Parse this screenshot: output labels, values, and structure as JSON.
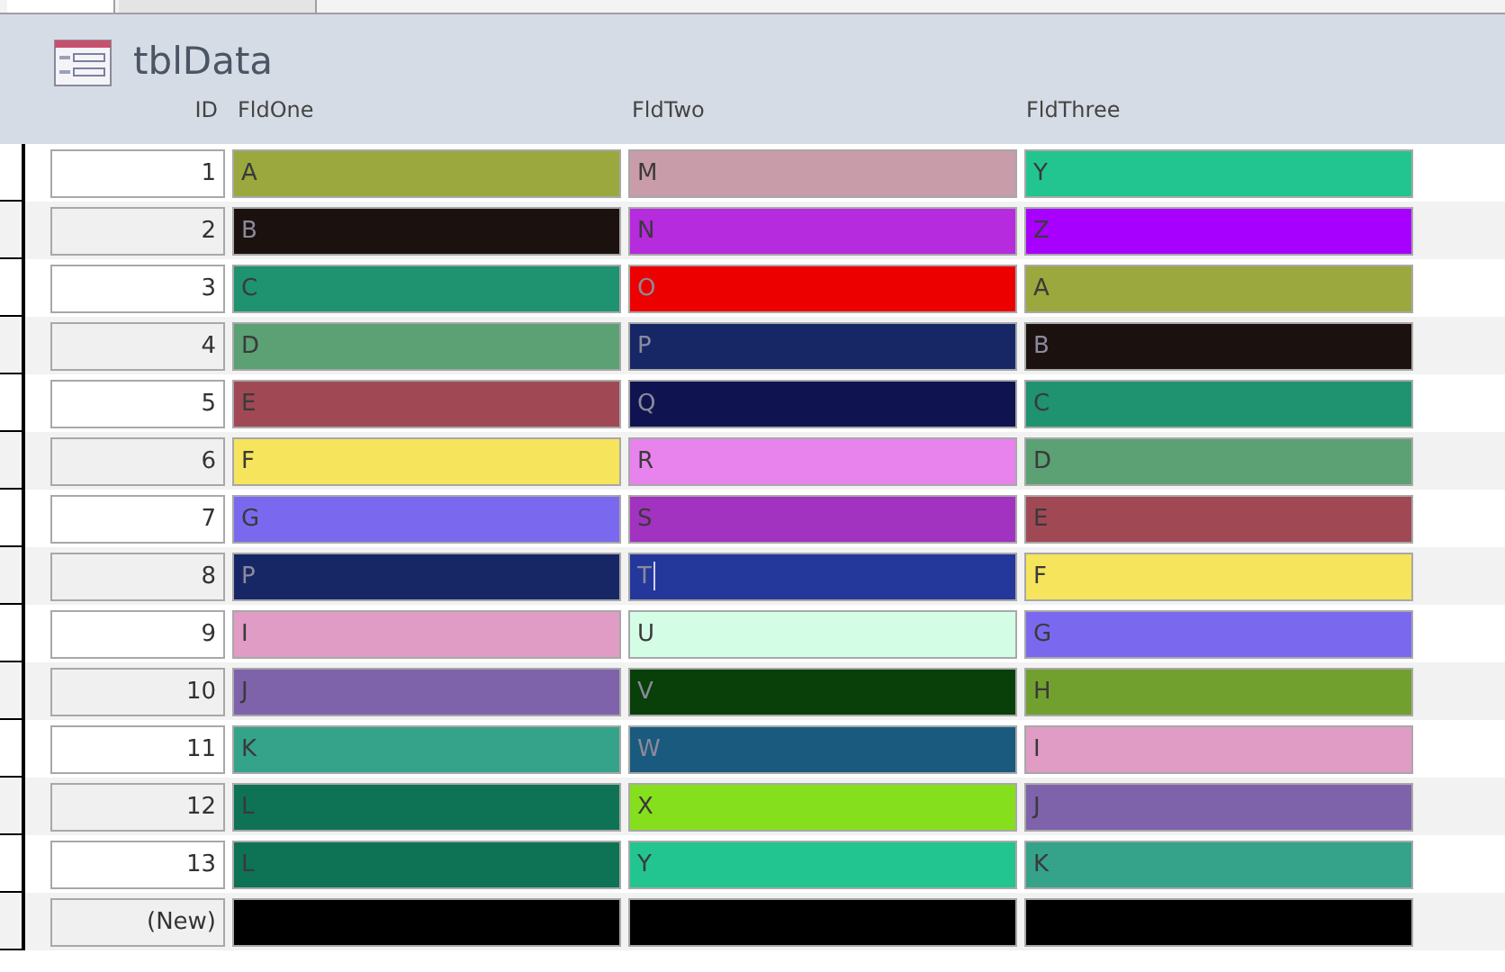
{
  "tabs": [
    {
      "selected": true
    },
    {
      "selected": false
    }
  ],
  "form": {
    "title": "tblData"
  },
  "columns": [
    "ID",
    "FldOne",
    "FldTwo",
    "FldThree"
  ],
  "rows": [
    {
      "id": "1",
      "cells": [
        {
          "value": "A",
          "color": "#9aa83e"
        },
        {
          "value": "M",
          "color": "#c89ca8"
        },
        {
          "value": "Y",
          "color": "#22c58f"
        }
      ]
    },
    {
      "id": "2",
      "cells": [
        {
          "value": "B",
          "color": "#1b1210"
        },
        {
          "value": "N",
          "color": "#b52bdd"
        },
        {
          "value": "Z",
          "color": "#a800ff"
        }
      ]
    },
    {
      "id": "3",
      "cells": [
        {
          "value": "C",
          "color": "#1f9270"
        },
        {
          "value": "O",
          "color": "#ec0000"
        },
        {
          "value": "A",
          "color": "#9aa83e"
        }
      ]
    },
    {
      "id": "4",
      "cells": [
        {
          "value": "D",
          "color": "#5ba173"
        },
        {
          "value": "P",
          "color": "#172766"
        },
        {
          "value": "B",
          "color": "#1b1210"
        }
      ]
    },
    {
      "id": "5",
      "cells": [
        {
          "value": "E",
          "color": "#a04955"
        },
        {
          "value": "Q",
          "color": "#0f1450"
        },
        {
          "value": "C",
          "color": "#1f9270"
        }
      ]
    },
    {
      "id": "6",
      "cells": [
        {
          "value": "F",
          "color": "#f6e45c"
        },
        {
          "value": "R",
          "color": "#e883ee"
        },
        {
          "value": "D",
          "color": "#5ba173"
        }
      ]
    },
    {
      "id": "7",
      "cells": [
        {
          "value": "G",
          "color": "#7a69ef"
        },
        {
          "value": "S",
          "color": "#a232c0"
        },
        {
          "value": "E",
          "color": "#a04955"
        }
      ]
    },
    {
      "id": "8",
      "cells": [
        {
          "value": "P",
          "color": "#172766"
        },
        {
          "value": "T",
          "color": "#24379a",
          "focused": true
        },
        {
          "value": "F",
          "color": "#f6e45c"
        }
      ]
    },
    {
      "id": "9",
      "cells": [
        {
          "value": "I",
          "color": "#e09cc4"
        },
        {
          "value": "U",
          "color": "#d4fde6"
        },
        {
          "value": "G",
          "color": "#7a69ef"
        }
      ]
    },
    {
      "id": "10",
      "cells": [
        {
          "value": "J",
          "color": "#7e63ab"
        },
        {
          "value": "V",
          "color": "#093f08"
        },
        {
          "value": "H",
          "color": "#72a02f"
        }
      ]
    },
    {
      "id": "11",
      "cells": [
        {
          "value": "K",
          "color": "#35a28a"
        },
        {
          "value": "W",
          "color": "#1a5a7e"
        },
        {
          "value": "I",
          "color": "#e09cc4"
        }
      ]
    },
    {
      "id": "12",
      "cells": [
        {
          "value": "L",
          "color": "#0d7354"
        },
        {
          "value": "X",
          "color": "#86df1c"
        },
        {
          "value": "J",
          "color": "#7e63ab"
        }
      ]
    },
    {
      "id": "13",
      "cells": [
        {
          "value": "L",
          "color": "#0d7354"
        },
        {
          "value": "Y",
          "color": "#22c58f"
        },
        {
          "value": "K",
          "color": "#35a28a"
        }
      ]
    },
    {
      "id": "(New)",
      "cells": [
        {
          "color": "#000000"
        },
        {
          "color": "#000000"
        },
        {
          "color": "#000000"
        }
      ]
    }
  ]
}
